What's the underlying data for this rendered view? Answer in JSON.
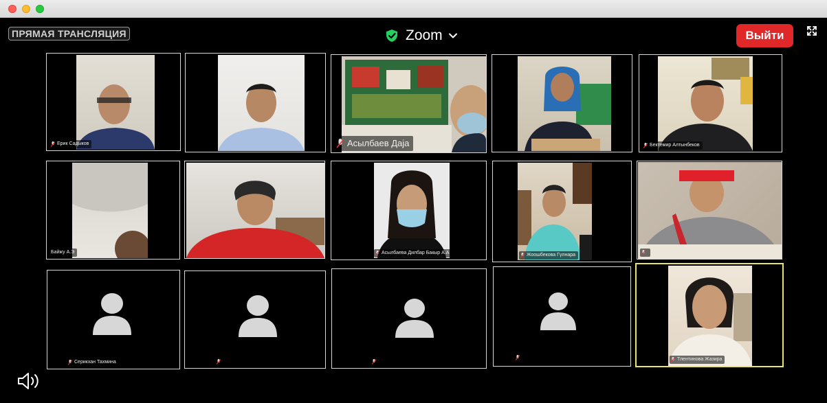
{
  "window": {
    "live_badge": "ПРЯМАЯ ТРАНСЛЯЦИЯ",
    "app_title": "Zoom",
    "leave_label": "Выйти",
    "shield_color": "#23d160",
    "leave_color": "#e02828"
  },
  "participants": [
    {
      "name": "Ерик Садыков",
      "video": true
    },
    {
      "name": "",
      "video": true
    },
    {
      "name": "Асылбаев Даја",
      "video": true
    },
    {
      "name": "",
      "video": true
    },
    {
      "name": "Бектемир Алтынбеков",
      "video": true
    },
    {
      "name": "Байжу А.Э",
      "video": true
    },
    {
      "name": "",
      "video": true
    },
    {
      "name": "Асылбаева Дилбар Бакыр А.А",
      "video": true
    },
    {
      "name": "Жоошбекова Гүлнара",
      "video": true
    },
    {
      "name": "",
      "video": true
    },
    {
      "name": "Серикхан Тахмина",
      "video": false
    },
    {
      "name": "",
      "video": false
    },
    {
      "name": "",
      "video": false
    },
    {
      "name": "",
      "video": false
    },
    {
      "name": "Тлентинова Жазира",
      "video": true
    }
  ]
}
